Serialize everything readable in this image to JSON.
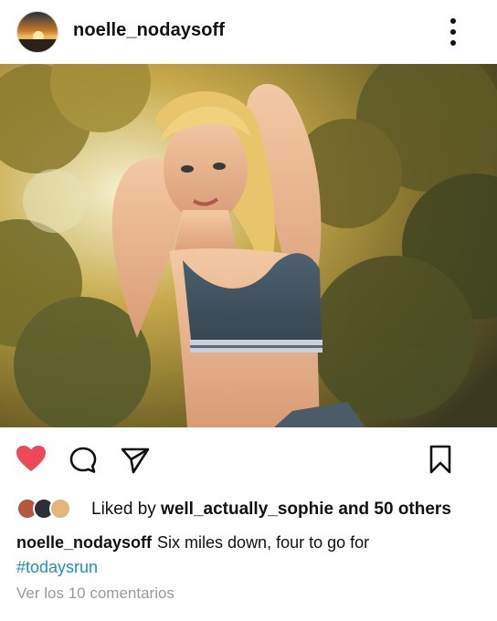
{
  "post": {
    "username": "noelle_nodaysoff",
    "more_icon": "more-vertical-icon"
  },
  "actions": {
    "like_icon": "heart-filled-icon",
    "like_color": "#ed4956",
    "comment_icon": "comment-icon",
    "share_icon": "send-icon",
    "save_icon": "bookmark-icon"
  },
  "likes": {
    "prefix": "Liked by ",
    "user": "well_actually_sophie",
    "suffix": " and 50 others"
  },
  "caption": {
    "username": "noelle_nodaysoff",
    "text": "Six miles down, four to go for",
    "hashtag": "#todaysrun",
    "hashtag_color": "#1e8fc9"
  },
  "comments": {
    "label": "Ver los 10 comentarios"
  }
}
